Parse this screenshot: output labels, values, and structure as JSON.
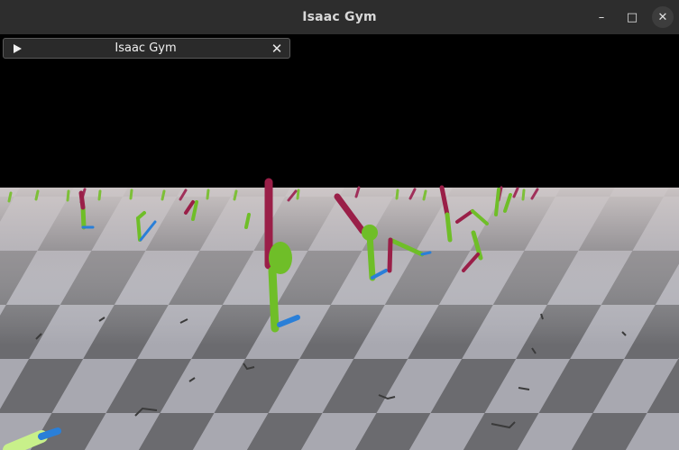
{
  "window": {
    "title": "Isaac Gym",
    "controls": {
      "minimize": "–",
      "maximize": "□",
      "close": "✕"
    }
  },
  "panel": {
    "title": "Isaac Gym",
    "play_icon": "play-icon",
    "close_icon": "close-icon"
  },
  "colors": {
    "titlebar": "#2d2d2d",
    "ground_light": "#a8a8b0",
    "ground_dark": "#6b6b6f",
    "horizon": "#c9c2c2",
    "robot_body": "#6fbe28",
    "robot_thigh": "#9a1f48",
    "robot_foot": "#2a7fd8"
  }
}
